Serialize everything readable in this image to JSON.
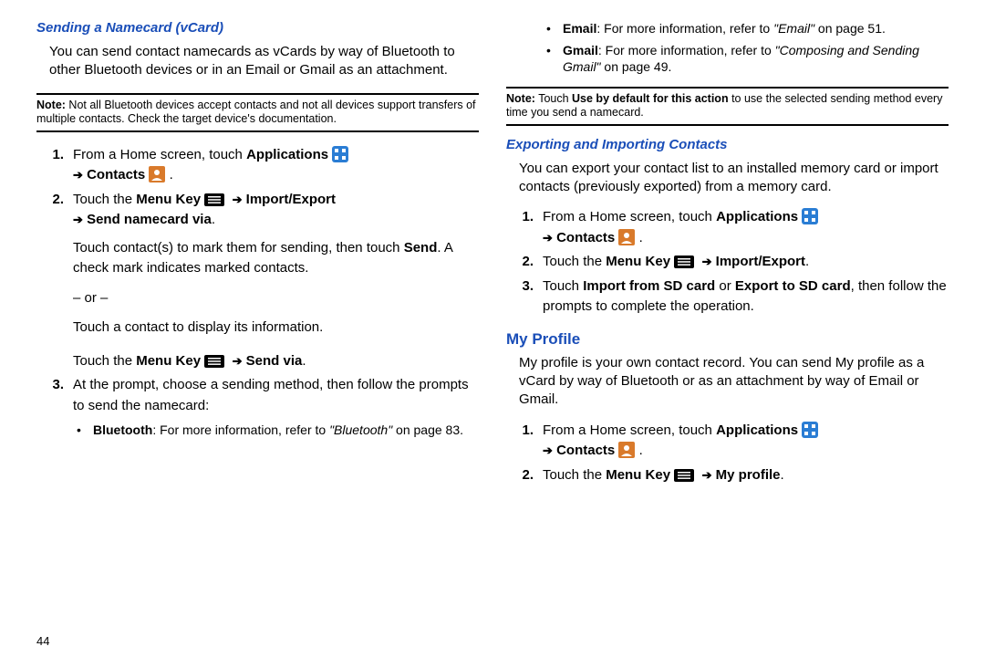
{
  "page_number": "44",
  "left": {
    "h_send_namecard": "Sending a Namecard (vCard)",
    "intro": "You can send contact namecards as vCards by way of Bluetooth to other Bluetooth devices or in an Email or Gmail as an attachment.",
    "note1_label": "Note:",
    "note1_body": " Not all Bluetooth devices accept contacts and not all devices support transfers of multiple contacts. Check the target device's documentation.",
    "s1_a": "From a Home screen, touch ",
    "s1_app": "Applications",
    "s1_contacts": "Contacts",
    "s2_a": "Touch the ",
    "s2_menu": "Menu Key",
    "s2_imp": "Import/Export",
    "s2_send": "Send namecard via",
    "s2_body1": "Touch contact(s) to mark them for sending, then touch ",
    "s2_send_btn": "Send",
    "s2_body2": ". A check mark indicates marked contacts.",
    "s2_or": "– or –",
    "s2_body3": "Touch a contact to display its information.",
    "s2_body4a": "Touch the ",
    "s2_body4b": "Menu Key",
    "s2_body4c": "Send via",
    "s3_a": "At the prompt, choose a sending method, then follow the prompts to send the namecard:",
    "s3_b1_a": "Bluetooth",
    "s3_b1_b": ": For more information, refer to ",
    "s3_b1_c": "\"Bluetooth\"",
    "s3_b1_d": "  on page 83."
  },
  "right": {
    "b_email_a": "Email",
    "b_email_b": ": For more information, refer to ",
    "b_email_c": "\"Email\"",
    "b_email_d": "  on page 51.",
    "b_gmail_a": "Gmail",
    "b_gmail_b": ": For more information, refer to ",
    "b_gmail_c": "\"Composing and Sending Gmail\"",
    "b_gmail_d": "  on page 49.",
    "note2_label": "Note:",
    "note2_a": " Touch ",
    "note2_b": "Use by default for this action",
    "note2_c": " to use the selected sending method every time you send a namecard.",
    "h_export": "Exporting and Importing Contacts",
    "exp_intro": "You can export your contact list to an installed memory card or import contacts (previously exported) from a memory card.",
    "e1_a": "From a Home screen, touch ",
    "e1_app": "Applications",
    "e1_contacts": "Contacts",
    "e2_a": "Touch the ",
    "e2_menu": "Menu Key",
    "e2_imp": "Import/Export",
    "e3_a": "Touch ",
    "e3_b": "Import from SD card",
    "e3_c": " or ",
    "e3_d": "Export to SD card",
    "e3_e": ", then follow the prompts to complete the operation.",
    "h_profile": "My Profile",
    "p_intro": "My profile is your own contact record. You can send My profile as a vCard by way of Bluetooth or as an attachment by way of Email or Gmail.",
    "p1_a": "From a Home screen, touch ",
    "p1_app": "Applications",
    "p1_contacts": "Contacts",
    "p2_a": "Touch the ",
    "p2_menu": "Menu Key",
    "p2_prof": "My profile"
  }
}
